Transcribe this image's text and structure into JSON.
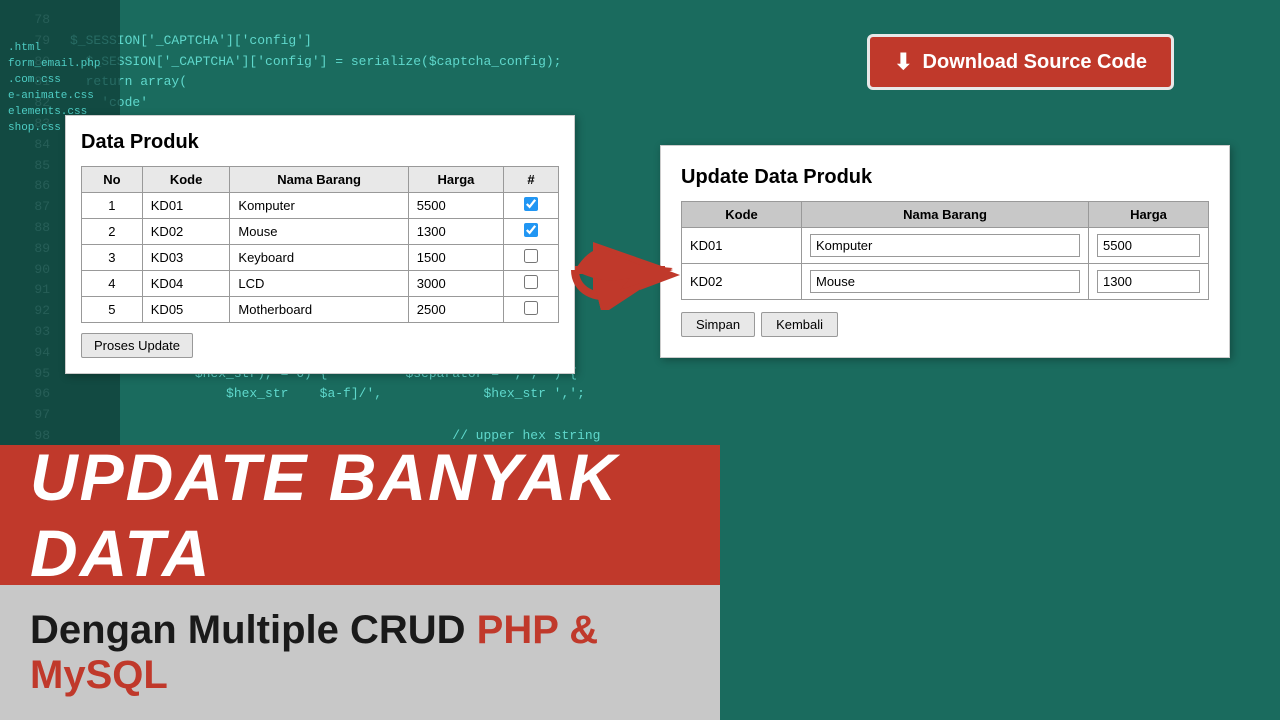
{
  "background": {
    "color": "#1a6b5e"
  },
  "download_button": {
    "label": "Download Source Code",
    "icon": "⬇"
  },
  "panel_left": {
    "title": "Data Produk",
    "table": {
      "headers": [
        "No",
        "Kode",
        "Nama Barang",
        "Harga",
        "#"
      ],
      "rows": [
        {
          "no": "1",
          "kode": "KD01",
          "nama": "Komputer",
          "harga": "5500",
          "checked": true
        },
        {
          "no": "2",
          "kode": "KD02",
          "nama": "Mouse",
          "harga": "1300",
          "checked": true
        },
        {
          "no": "3",
          "kode": "KD03",
          "nama": "Keyboard",
          "harga": "1500",
          "checked": false
        },
        {
          "no": "4",
          "kode": "KD04",
          "nama": "LCD",
          "harga": "3000",
          "checked": false
        },
        {
          "no": "5",
          "kode": "KD05",
          "nama": "Motherboard",
          "harga": "2500",
          "checked": false
        }
      ]
    },
    "button": "Proses Update"
  },
  "panel_right": {
    "title": "Update Data Produk",
    "table": {
      "headers": [
        "Kode",
        "Nama Barang",
        "Harga"
      ],
      "rows": [
        {
          "kode": "KD01",
          "nama": "Komputer",
          "harga": "5500"
        },
        {
          "kode": "KD02",
          "nama": "Mouse",
          "harga": "1300"
        }
      ]
    },
    "buttons": {
      "simpan": "Simpan",
      "kembali": "Kembali"
    }
  },
  "bottom_banner": {
    "main_title": "UPDATE BANYAK DATA",
    "sub_title_plain": "Dengan Multiple CRUD ",
    "sub_title_highlight": "PHP & MySQL"
  },
  "css_files": [
    "html",
    "form_email.php",
    ".com.css",
    "e-animate.css",
    "shop.css",
    "elements.css"
  ]
}
